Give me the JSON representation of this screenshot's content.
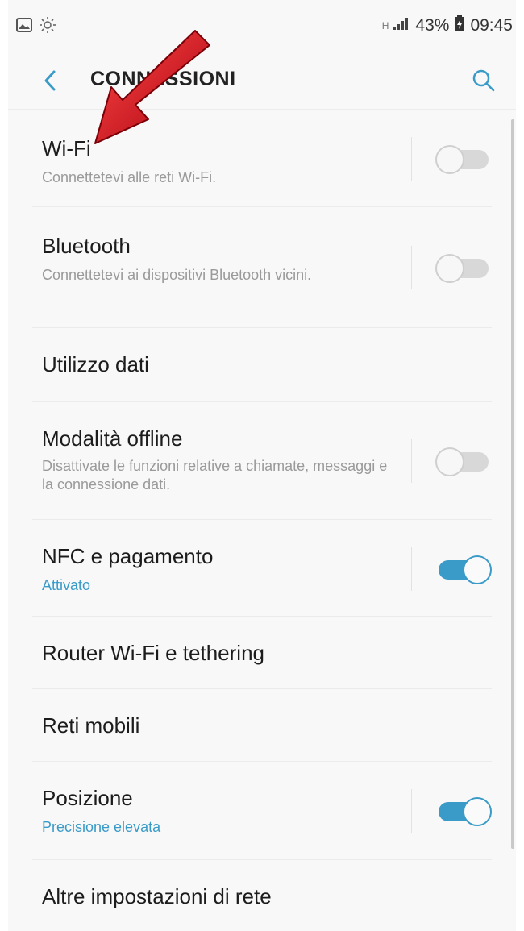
{
  "statusbar": {
    "signal_text": "░ ",
    "battery_percent": "43%",
    "time": "09:45",
    "net_small": "H"
  },
  "appbar": {
    "title": "CONNESSIONI"
  },
  "items": [
    {
      "label": "Wi-Fi",
      "subtitle": "Connettetevi alle reti Wi-Fi.",
      "toggle": "off"
    },
    {
      "label": "Bluetooth",
      "subtitle": "Connettetevi ai dispositivi Bluetooth vicini.",
      "toggle": "off"
    },
    {
      "label": "Utilizzo dati"
    },
    {
      "label": "Modalità offline",
      "subtitle": "Disattivate le funzioni relative a chiamate, messaggi e la connessione dati.",
      "toggle": "off"
    },
    {
      "label": "NFC e pagamento",
      "subtitle": "Attivato",
      "toggle": "on"
    },
    {
      "label": "Router Wi-Fi e tethering"
    },
    {
      "label": "Reti mobili"
    },
    {
      "label": "Posizione",
      "subtitle": "Precisione elevata",
      "toggle": "on"
    },
    {
      "label": "Altre impostazioni di rete"
    }
  ],
  "colors": {
    "accent": "#3a9bc8",
    "arrow": "#c8101a"
  },
  "icons": {
    "status_left": [
      "gallery-icon",
      "brightness-icon"
    ],
    "status_right": [
      "data-icon",
      "signal-icon",
      "battery-icon"
    ],
    "appbar": [
      "back-arrow-icon",
      "search-icon"
    ]
  }
}
